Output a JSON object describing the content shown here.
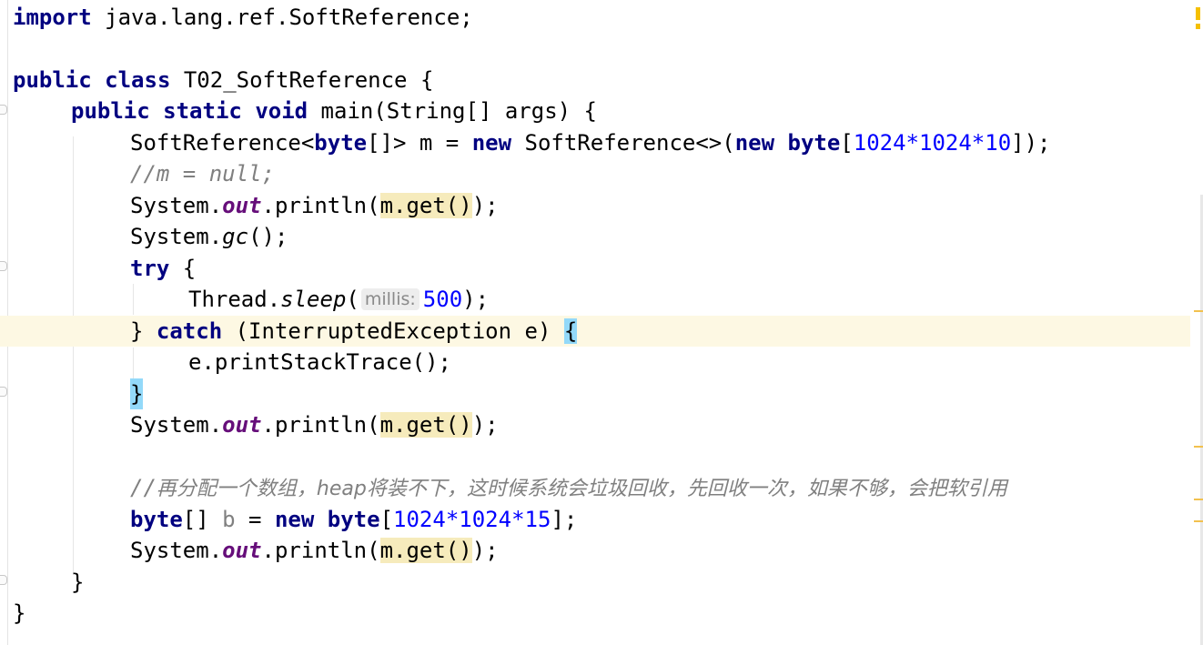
{
  "code": {
    "l1": {
      "kw_import": "import",
      "rest": " java.lang.ref.SoftReference;"
    },
    "l3": {
      "kw_public": "public",
      "kw_class": "class",
      "name": " T02_SoftReference {"
    },
    "l4": {
      "kw_public": "public",
      "kw_static": "static",
      "kw_void": "void",
      "sig": " main(String[] args) {"
    },
    "l5": {
      "p1": "SoftReference<",
      "kw_byte1": "byte",
      "p2": "[]> m = ",
      "kw_new1": "new",
      "p3": " SoftReference<>(",
      "kw_new2": "new",
      "kw_byte2": "byte",
      "p4": "[",
      "n1": "1024",
      "star1": "*",
      "n2": "1024",
      "star2": "*",
      "n3": "10",
      "p5": "]);"
    },
    "l6": {
      "comment": "//m = null;"
    },
    "l7": {
      "sys": "System.",
      "out": "out",
      "println": ".println(",
      "mget": "m.get()",
      "end": ");"
    },
    "l8": {
      "sys": "System.",
      "gc": "gc",
      "end": "();"
    },
    "l9": {
      "kw_try": "try",
      "rest": " {"
    },
    "l10": {
      "p1": "Thread.",
      "sleep": "sleep",
      "p2": "(",
      "hint": "millis:",
      "n": "500",
      "end": ");"
    },
    "l11": {
      "p1": "} ",
      "kw_catch": "catch",
      "p2": " (InterruptedException e) ",
      "brace": "{"
    },
    "l12": {
      "text": "e.printStackTrace();"
    },
    "l13": {
      "brace": "}"
    },
    "l14": {
      "sys": "System.",
      "out": "out",
      "println": ".println(",
      "mget": "m.get()",
      "end": ");"
    },
    "l16": {
      "comment_slash": "//",
      "comment_cjk": "再分配一个数组，heap将装不下，这时候系统会垃圾回收，先回收一次，如果不够，会把软引用"
    },
    "l17": {
      "kw_byte": "byte",
      "p1": "[] ",
      "var_b": "b",
      "p2": " = ",
      "kw_new": "new",
      "kw_byte2": "byte",
      "p3": "[",
      "n1": "1024",
      "star1": "*",
      "n2": "1024",
      "star2": "*",
      "n3": "15",
      "end": "];"
    },
    "l18": {
      "sys": "System.",
      "out": "out",
      "println": ".println(",
      "mget": "m.get()",
      "end": ");"
    },
    "l19": {
      "text": "}"
    },
    "l20": {
      "text": "}"
    }
  },
  "colors": {
    "keyword": "#000080",
    "number": "#0000ff",
    "static_field": "#660e7a",
    "comment": "#808080",
    "usage_highlight": "#f6ebbc",
    "brace_match": "#93d9f9",
    "caret_row": "#fdf8e3"
  },
  "icons": [
    "fold-marker-icon",
    "warning-stripe-icon"
  ]
}
